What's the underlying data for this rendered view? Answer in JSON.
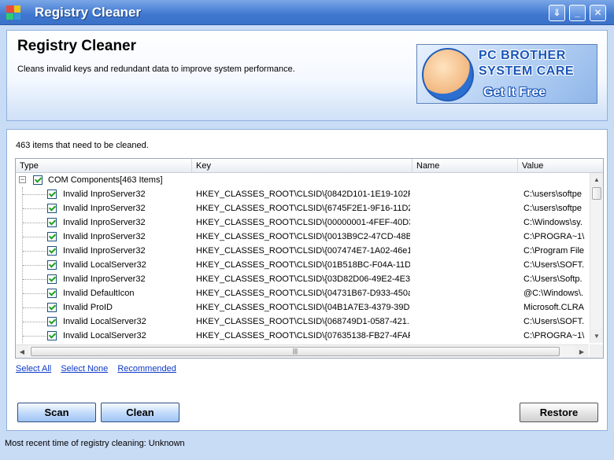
{
  "window": {
    "title": "Registry Cleaner",
    "buttons": [
      "⇓",
      "_",
      "✕"
    ]
  },
  "header": {
    "title": "Registry Cleaner",
    "description": "Cleans invalid keys and redundant data to improve system performance.",
    "ad": {
      "line1": "PC BROTHER",
      "line2": "SYSTEM CARE",
      "line3": "Get It Free"
    }
  },
  "main": {
    "items_count": "463 items that need to be cleaned.",
    "columns": [
      "Type",
      "Key",
      "Name",
      "Value"
    ],
    "group": {
      "label": "COM Components[463 Items]",
      "toggle": "−"
    },
    "rows": [
      {
        "type": "Invalid InproServer32",
        "key": "HKEY_CLASSES_ROOT\\CLSID\\{0842D101-1E19-102F-...",
        "name": "",
        "value": "C:\\users\\softpe"
      },
      {
        "type": "Invalid InproServer32",
        "key": "HKEY_CLASSES_ROOT\\CLSID\\{6745F2E1-9F16-11D2-...",
        "name": "",
        "value": "C:\\users\\softpe"
      },
      {
        "type": "Invalid InproServer32",
        "key": "HKEY_CLASSES_ROOT\\CLSID\\{00000001-4FEF-40D3...",
        "name": "",
        "value": "C:\\Windows\\sy."
      },
      {
        "type": "Invalid InproServer32",
        "key": "HKEY_CLASSES_ROOT\\CLSID\\{0013B9C2-47CD-48B...",
        "name": "",
        "value": "C:\\PROGRA~1\\"
      },
      {
        "type": "Invalid InproServer32",
        "key": "HKEY_CLASSES_ROOT\\CLSID\\{007474E7-1A02-46e1...",
        "name": "",
        "value": "C:\\Program File"
      },
      {
        "type": "Invalid LocalServer32",
        "key": "HKEY_CLASSES_ROOT\\CLSID\\{01B518BC-F04A-11D...",
        "name": "",
        "value": "C:\\Users\\SOFT."
      },
      {
        "type": "Invalid InproServer32",
        "key": "HKEY_CLASSES_ROOT\\CLSID\\{03D82D06-49E2-4E3...",
        "name": "",
        "value": "C:\\Users\\Softp."
      },
      {
        "type": "Invalid DefaultIcon",
        "key": "HKEY_CLASSES_ROOT\\CLSID\\{04731B67-D933-450a...",
        "name": "",
        "value": "@C:\\Windows\\."
      },
      {
        "type": "Invalid ProID",
        "key": "HKEY_CLASSES_ROOT\\CLSID\\{04B1A7E3-4379-39D...",
        "name": "",
        "value": "Microsoft.CLRA"
      },
      {
        "type": "Invalid LocalServer32",
        "key": "HKEY_CLASSES_ROOT\\CLSID\\{068749D1-0587-421...",
        "name": "",
        "value": "C:\\Users\\SOFT."
      },
      {
        "type": "Invalid LocalServer32",
        "key": "HKEY_CLASSES_ROOT\\CLSID\\{07635138-FB27-4FAF...",
        "name": "",
        "value": "C:\\PROGRA~1\\"
      }
    ],
    "hscroll_grip": "|||",
    "links": {
      "select_all": "Select All",
      "select_none": "Select None",
      "recommended": "Recommended"
    },
    "buttons": {
      "scan": "Scan",
      "clean": "Clean",
      "restore": "Restore"
    }
  },
  "status": "Most recent time of registry cleaning: Unknown",
  "colors": {
    "titlebar": "#3f78d0",
    "accent": "#0b38c9",
    "checkmark": "#21a121"
  }
}
